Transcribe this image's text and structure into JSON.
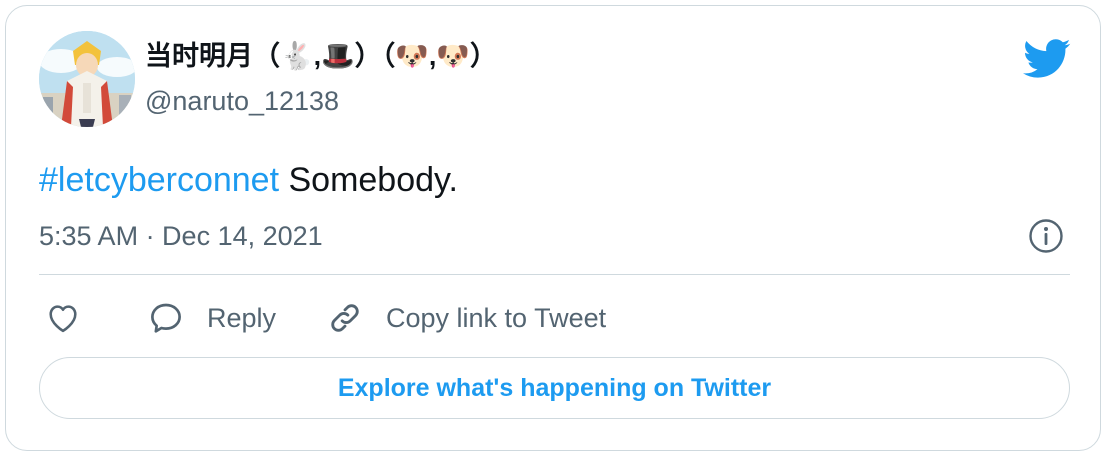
{
  "tweet": {
    "author": {
      "display_name": "当时明月（🐇,🎩）（🐶,🐶）",
      "handle": "@naruto_12138"
    },
    "text": {
      "hashtag": "#letcyberconnet",
      "body": " Somebody."
    },
    "timestamp": "5:35 AM · Dec 14, 2021"
  },
  "actions": {
    "reply_label": "Reply",
    "copy_link_label": "Copy link to Tweet"
  },
  "explore_button_label": "Explore what's happening on Twitter",
  "colors": {
    "accent": "#1d9bf0",
    "text_primary": "#0f1419",
    "text_secondary": "#536471",
    "border": "#cfd9de"
  },
  "icons": {
    "brand": "twitter-bird-icon",
    "info": "info-icon",
    "like": "heart-icon",
    "reply": "speech-bubble-icon",
    "copy_link": "link-icon"
  }
}
